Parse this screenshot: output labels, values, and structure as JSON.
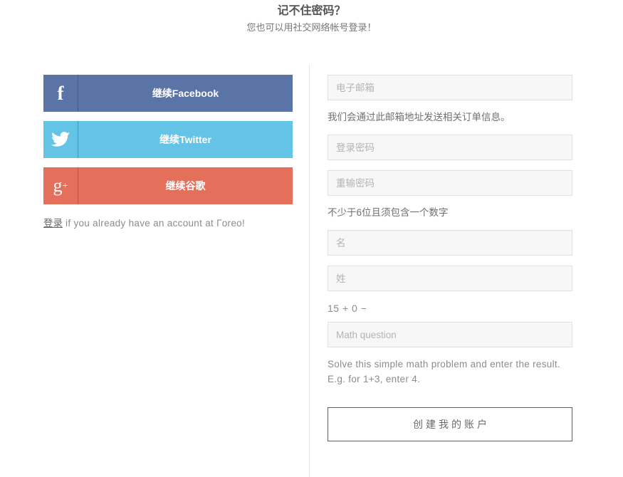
{
  "header": {
    "title": "记不住密码？",
    "subtitle": "您也可以用社交网络帐号登录！"
  },
  "social": {
    "facebook": {
      "icon": "facebook-f-icon",
      "glyph": "f",
      "label": "继续Facebook",
      "color": "#5b74a8"
    },
    "twitter": {
      "icon": "twitter-bird-icon",
      "glyph": "🐦",
      "label": "继续Twitter",
      "color": "#63c4e8"
    },
    "google": {
      "icon": "google-plus-icon",
      "glyph": "g",
      "glyph_sup": "+",
      "label": "继续谷歌",
      "color": "#e4705c"
    }
  },
  "login_hint": {
    "link_text": "登录",
    "rest_text": " if you already have an account at Гoreo!"
  },
  "form": {
    "email_placeholder": "电子邮箱",
    "email_help": "我们会通过此邮箱地址发送相关订单信息。",
    "password_placeholder": "登录密码",
    "password_confirm_placeholder": "重输密码",
    "password_help": "不少于6位且须包含一个数字",
    "first_name_placeholder": "名",
    "last_name_placeholder": "姓",
    "math_label": "15 + 0 −",
    "math_placeholder": "Math question",
    "math_help": "Solve this simple math problem and enter the result. E.g. for 1+3, enter 4.",
    "submit_label": "创建我的账户"
  }
}
